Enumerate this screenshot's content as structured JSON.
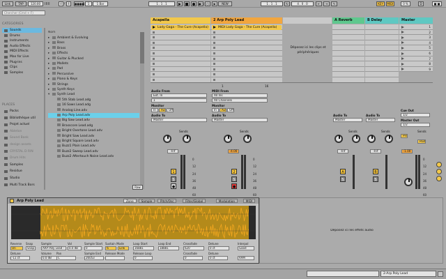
{
  "transport": {
    "link": "Link",
    "tap": "TAP",
    "tempo": "120.00",
    "sig_num": "4",
    "sig_den": "4",
    "metro_labels": [
      "●●●●",
      "●○○○"
    ],
    "quant": "1 Bar",
    "position": "1 .  1 .  1",
    "new_label": "NEW",
    "pos2": "1 .  1 .  1",
    "loop_len": "4 .  0 .  0",
    "key": "KEY",
    "midi": "MIDI",
    "cpu": "0 %",
    "d_label": "D"
  },
  "browser": {
    "search_placeholder": "Chercher (Cmd + F)",
    "categories_title": "CATEGORIES",
    "categories": [
      "Sounds",
      "Drums",
      "Instruments",
      "Audio Effects",
      "MIDI Effects",
      "Max for Live",
      "Plug-ins",
      "Clips",
      "Samples"
    ],
    "selected_category": 0,
    "places_title": "PLACES",
    "places": [
      "Packs",
      "Bibliothèque util",
      "Projet actuel",
      "Ableton",
      "Sound Bank",
      "design assets",
      "CRYSTAL D RIN",
      "Drum Hits",
      "Samples",
      "Residue",
      "Studio",
      "Multi Track Bors"
    ],
    "column_header": "Nom",
    "folders": [
      "Ambient & Evolving",
      "Bass",
      "Brass",
      "Effects",
      "Guitar & Plucked",
      "Mallets",
      "Pad",
      "Percussive",
      "Piano & Keys",
      "Strings",
      "Synth Keys",
      "Synth Lead"
    ],
    "files": [
      "5th Stab Lead.adg",
      "16 Saws Lead.adg",
      "Analog Line.adv",
      "Arp Poly Lead.adv",
      "Big Saw Lead.adv",
      "Brasscore Lead.adg",
      "Bright Overtone Lead.adv",
      "Bright Saw Lead.adv",
      "Bright Square Lead.adv",
      "Buzz1 Plain Lead.adv",
      "Buzz2 Sweep Lead.adv",
      "Buzz2 Aftertouch Noise Lead.adv"
    ],
    "selected_file": 3,
    "raw_label": "Raw"
  },
  "tracks": [
    {
      "name": "Acapella",
      "color": "#f2c84b",
      "clip": "Lady Gaga - The Cure (Acapella)",
      "clip_color": "#f2c84b",
      "input_type": "Audio From",
      "input": "Ext. In",
      "input_ch": "1",
      "monitor": [
        "In",
        "Auto",
        "Off"
      ],
      "out_label": "Audio To",
      "out": "Master",
      "vol": "-Inf",
      "num": "1",
      "db_ticks": [
        "0",
        "12",
        "24",
        "36",
        "48",
        "60"
      ]
    },
    {
      "name": "2 Arp Poly Lead",
      "color": "#f2a63e",
      "clip": "MIDI Lady Gaga - The Cure (Acapella)",
      "clip_color": "#f2c84b",
      "input_type": "MIDI From",
      "input": "All Ins",
      "input_ch": "All Channels",
      "monitor": [
        "In",
        "Auto",
        "Off"
      ],
      "out_label": "Audio To",
      "out": "Master",
      "vol": "-4.00",
      "num": "2",
      "db_ticks": [
        "0",
        "12",
        "24",
        "36",
        "48",
        "60"
      ]
    }
  ],
  "drop_clips": "Déposez ici les clips et périphériques",
  "returns": [
    {
      "name": "A Reverb",
      "color": "#5fc88e",
      "out": "Master",
      "vol": "-Inf",
      "num": "A",
      "out_label": "Audio To"
    },
    {
      "name": "B Delay",
      "color": "#5fc8c2",
      "out": "Master",
      "vol": "-Inf",
      "num": "B",
      "out_label": "Audio To"
    }
  ],
  "master": {
    "name": "Master",
    "color": "#5fc8c2",
    "cue_label": "Cue Out",
    "cue": "1/2",
    "mout_label": "Master Out",
    "mout": "1/2",
    "vol": "-1.00",
    "db_ticks": [
      "0",
      "12",
      "24",
      "36",
      "48",
      "60"
    ],
    "scene_nums": [
      "1",
      "2",
      "3",
      "4",
      "5",
      "6",
      "7",
      "8",
      "9"
    ]
  },
  "sends_label": "Sends",
  "clip_counter": [
    "1",
    "16"
  ],
  "detail": {
    "device_title": "Arp Poly Lead",
    "tabs": [
      "Zone",
      "Sample",
      "Pitch/Osc",
      "Filter/Global",
      "Modulation",
      "MIDI"
    ],
    "labels": [
      "Reverse",
      "Snap",
      "Sample",
      "Vol",
      "Sample Start",
      "Sustain Mode",
      "Loop Start",
      "Loop End",
      "Crossfade",
      "Detune",
      "Interpol"
    ],
    "values": {
      "sample": "ARP Poly Lead – Forte",
      "vol": "0.0 dB",
      "start": "0",
      "end": "26053",
      "loop_start": "16881",
      "loop_end": "18881",
      "xfade": "620",
      "detune": "0 ct",
      "interp": "Good"
    },
    "row3": [
      "Detune",
      "Volume",
      "Pan",
      "Sample End",
      "Release Mode",
      "Release Loop",
      "Crossfade",
      "Detune"
    ],
    "row3_vals": [
      "-11 ct",
      "0.0 dB",
      "C",
      "26053",
      "",
      "0",
      "0",
      "0 ct"
    ],
    "ram": "RAM",
    "lnk": "Link",
    "on": "On"
  },
  "drop_effects": "Déposez ici les effets audio",
  "status": {
    "track": "2-Arp Poly Lead"
  }
}
